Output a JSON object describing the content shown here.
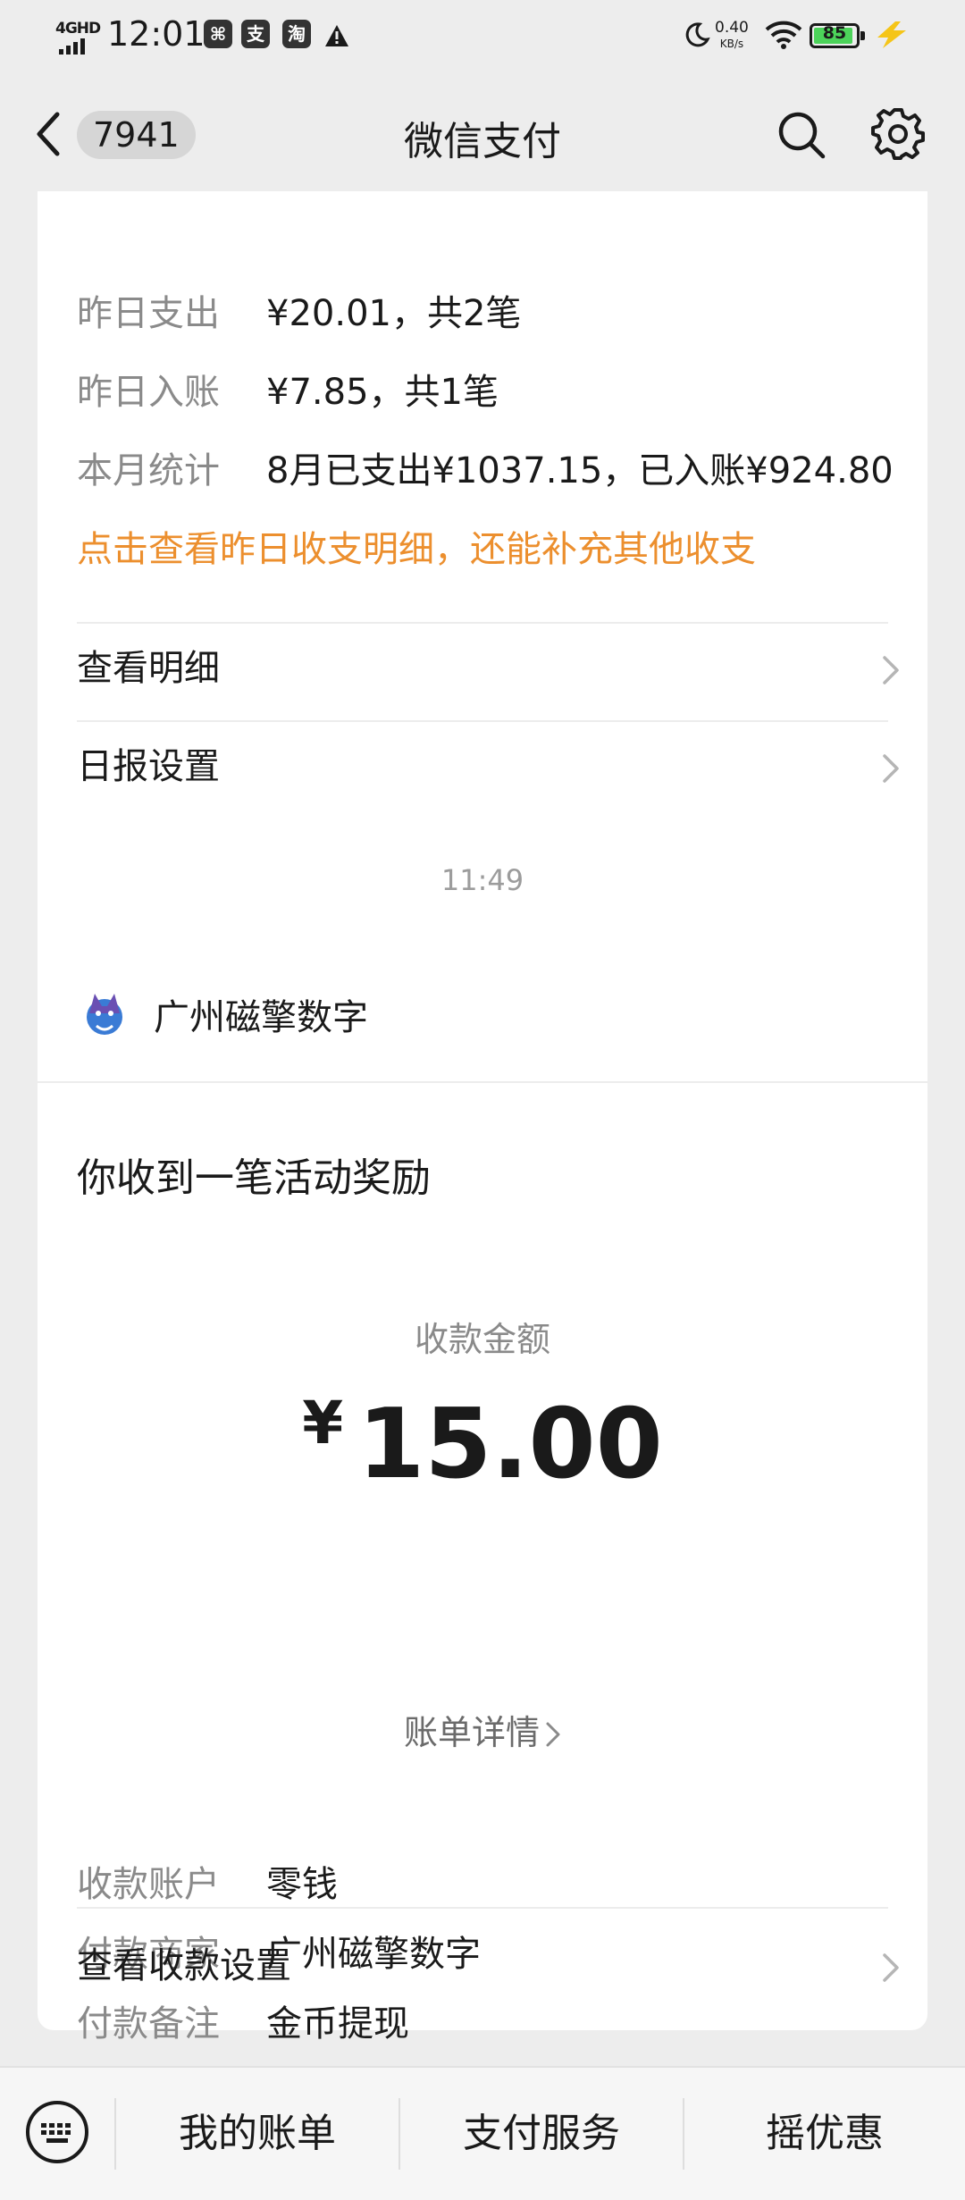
{
  "status_bar": {
    "network": "4GHD",
    "time": "12:01",
    "speed_value": "0.40",
    "speed_unit": "KB/s",
    "battery_level": "85"
  },
  "nav": {
    "badge": "7941",
    "title": "微信支付"
  },
  "daily_card": {
    "rows": [
      {
        "label": "昨日支出",
        "value": "¥20.01，共2笔"
      },
      {
        "label": "昨日入账",
        "value": "¥7.85，共1笔"
      },
      {
        "label": "本月统计",
        "value": "8月已支出¥1037.15，已入账¥924.80"
      }
    ],
    "hint": "点击查看昨日收支明细，还能补充其他收支",
    "links": [
      "查看明细",
      "日报设置"
    ]
  },
  "time_separator": "11:49",
  "payment_card": {
    "merchant": "广州磁擎数字",
    "title": "你收到一笔活动奖励",
    "amount_label": "收款金额",
    "currency": "¥",
    "amount": "15.00",
    "bill_link": "账单详情",
    "details": [
      {
        "label": "收款账户",
        "value": "零钱"
      },
      {
        "label": "付款商家",
        "value": "广州磁擎数字"
      },
      {
        "label": "付款备注",
        "value": "金币提现"
      }
    ],
    "settings_link": "查看收款设置"
  },
  "bottom_bar": {
    "tabs": [
      "我的账单",
      "支付服务",
      "摇优惠"
    ]
  },
  "colors": {
    "background": "#ededed",
    "card": "#ffffff",
    "hint_orange": "#ec8f2e",
    "battery_green": "#4cd35a"
  }
}
